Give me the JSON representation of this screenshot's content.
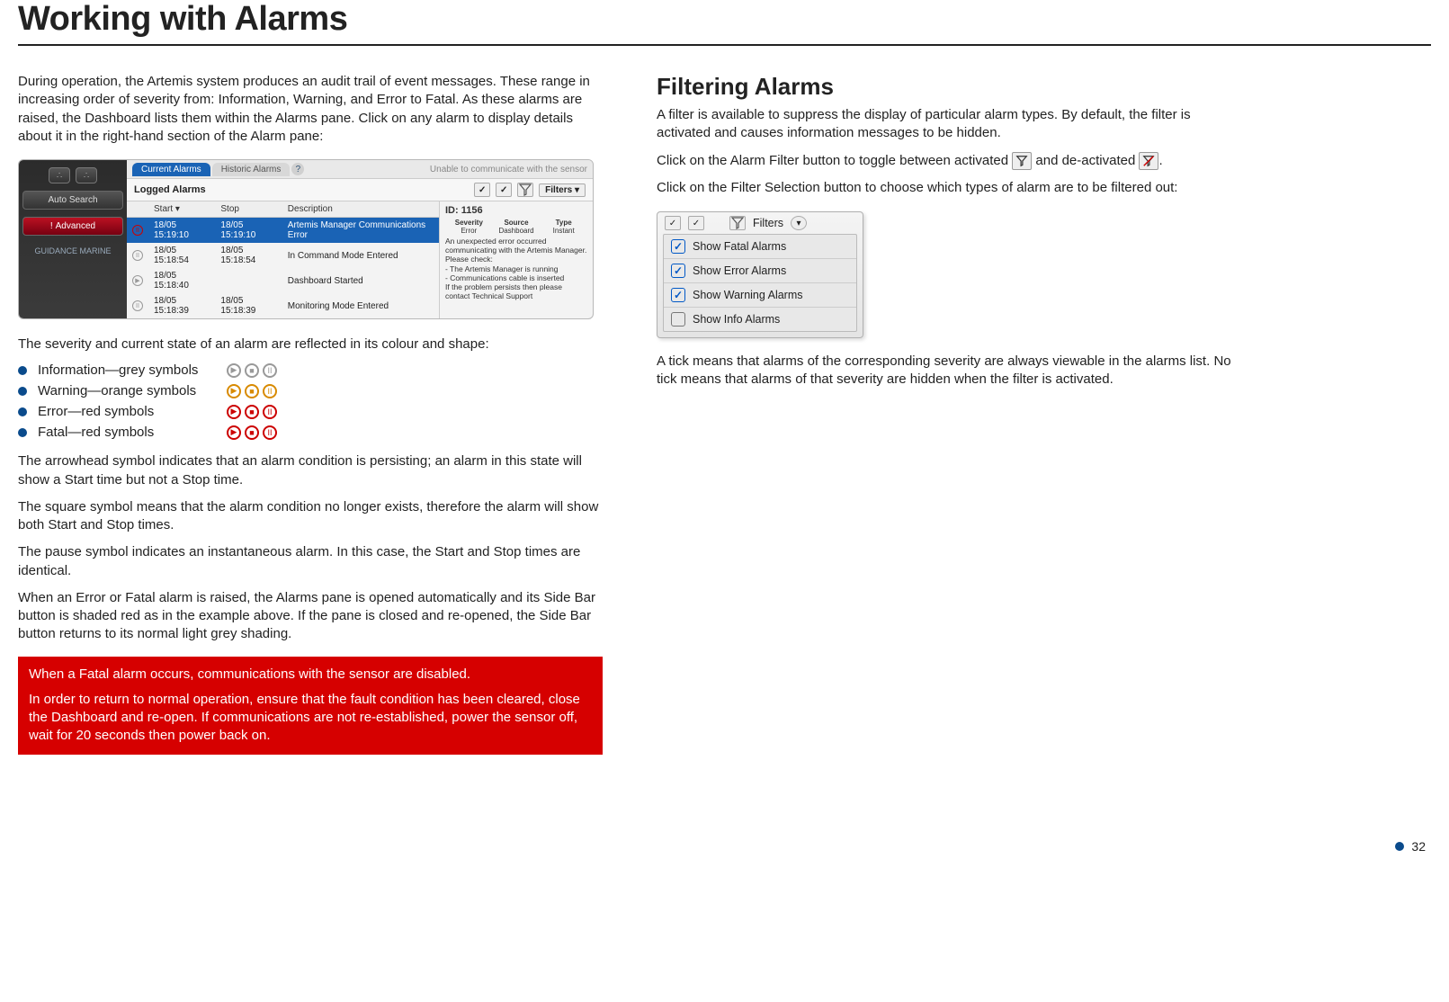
{
  "page": {
    "title": "Working with Alarms",
    "number": "32"
  },
  "col1": {
    "intro": "During operation, the Artemis system produces an audit trail of event messages. These range in increasing order of severity from: Information, Warning, and Error to Fatal. As these alarms are raised, the Dashboard lists them within the Alarms pane. Click on any alarm to display details about it in the right-hand section of the Alarm pane:",
    "severity_intro": "The severity and current state of an alarm are reflected in its colour and shape:",
    "severity_items": [
      "Information—grey symbols",
      "Warning—orange symbols",
      "Error—red symbols",
      "Fatal—red symbols"
    ],
    "para_arrowhead": "The arrowhead symbol indicates that an alarm condition is persisting; an alarm in this state will show a Start time but not a Stop time.",
    "para_square": "The square symbol means that the alarm condition no longer exists, therefore the alarm will show both Start and Stop times.",
    "para_pause": "The pause symbol indicates an instantaneous alarm. In this case, the Start and Stop times are identical.",
    "para_error_open": "When an Error or Fatal alarm is raised, the Alarms pane is opened automatically and its Side Bar button is shaded red as in the example above. If the pane is closed and re-opened, the Side Bar button returns to its normal light grey shading.",
    "warning_line1": "When a Fatal alarm occurs, communications with the sensor are disabled.",
    "warning_line2": "In order to return to normal operation, ensure that the fault condition has been cleared, close the Dashboard and re-open. If communications are not re-established, power the sensor off, wait for 20 seconds then power back on."
  },
  "alarms_pane": {
    "tab_current": "Current Alarms",
    "tab_historic": "Historic Alarms",
    "help": "?",
    "status": "Unable to communicate with the sensor",
    "logged_title": "Logged Alarms",
    "filters_label": "Filters",
    "cols": {
      "start": "Start",
      "stop": "Stop",
      "desc": "Description"
    },
    "rows": [
      {
        "start": "18/05 15:19:10",
        "stop": "18/05 15:19:10",
        "desc": "Artemis Manager Communications Error"
      },
      {
        "start": "18/05 15:18:54",
        "stop": "18/05 15:18:54",
        "desc": "In Command Mode Entered"
      },
      {
        "start": "18/05 15:18:40",
        "stop": "",
        "desc": "Dashboard Started"
      },
      {
        "start": "18/05 15:18:39",
        "stop": "18/05 15:18:39",
        "desc": "Monitoring Mode Entered"
      }
    ],
    "detail": {
      "id_label": "ID:  1156",
      "sev_lbl": "Severity",
      "sev_val": "Error",
      "src_lbl": "Source",
      "src_val": "Dashboard",
      "typ_lbl": "Type",
      "typ_val": "Instant",
      "body": "An unexpected error occurred communicating with the Artemis Manager. Please check:\n- The Artemis Manager is running\n- Communications cable is inserted\nIf the problem persists then please contact Technical Support"
    },
    "sidebar": {
      "auto_search": "Auto Search",
      "advanced": "Advanced",
      "logo": "GUIDANCE MARINE"
    }
  },
  "col2": {
    "heading": "Filtering Alarms",
    "p1": "A filter is available to suppress the display of particular alarm types. By default, the filter is activated and causes information messages to be hidden.",
    "p2a": "Click on the Alarm Filter button to toggle between activated ",
    "p2b": " and de-activated ",
    "p2c": ".",
    "p3": "Click on the Filter Selection button to choose which types of alarm are to be filtered out:",
    "p_tick": "A tick means that alarms of the corresponding severity are always viewable in the alarms list. No tick means that alarms of that severity are hidden when the filter is activated."
  },
  "filter_dropdown": {
    "filters_label": "Filters",
    "items": [
      {
        "label": "Show Fatal Alarms",
        "checked": true
      },
      {
        "label": "Show Error Alarms",
        "checked": true
      },
      {
        "label": "Show Warning Alarms",
        "checked": true
      },
      {
        "label": "Show Info Alarms",
        "checked": false
      }
    ]
  }
}
